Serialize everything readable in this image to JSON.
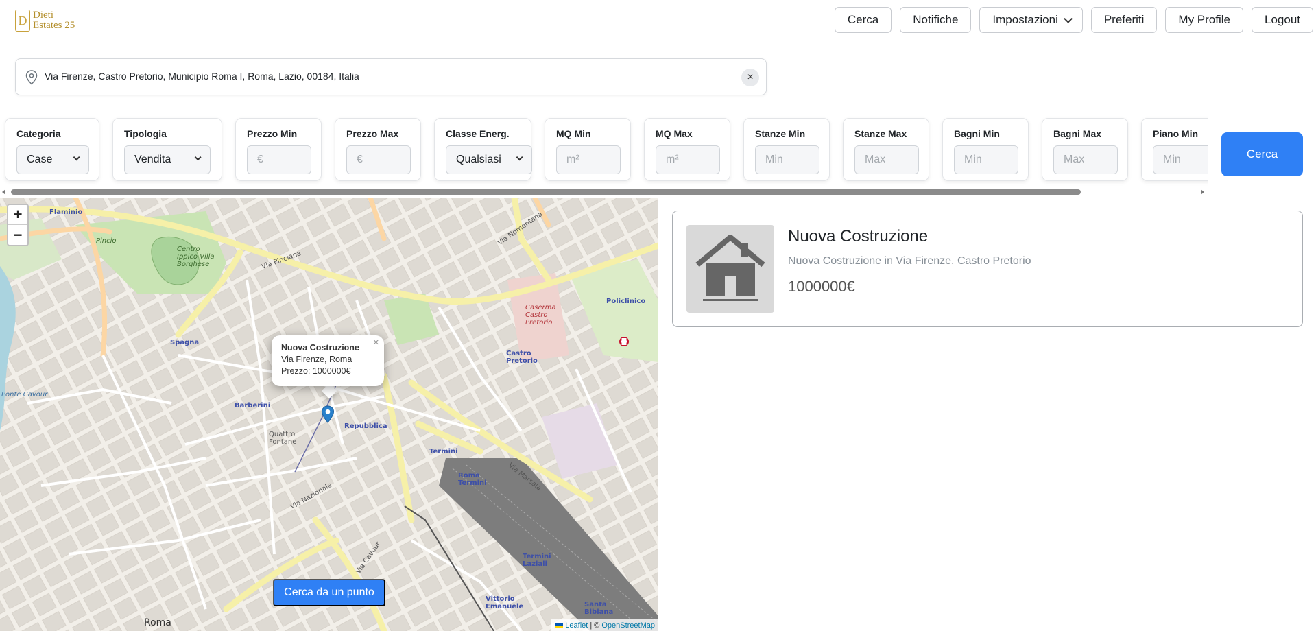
{
  "brand": {
    "name_line1": "Dieti",
    "name_line2": "Estates 25",
    "mark": "D"
  },
  "nav": {
    "cerca": "Cerca",
    "notifiche": "Notifiche",
    "impostazioni": "Impostazioni",
    "preferiti": "Preferiti",
    "profile": "My Profile",
    "logout": "Logout"
  },
  "search": {
    "address": "Via Firenze, Castro Pretorio, Municipio Roma I, Roma, Lazio, 00184, Italia",
    "clear_icon": "×"
  },
  "filters": [
    {
      "label": "Categoria",
      "value": "Case",
      "type": "select"
    },
    {
      "label": "Tipologia",
      "value": "Vendita",
      "type": "select"
    },
    {
      "label": "Prezzo Min",
      "placeholder": "€",
      "type": "input"
    },
    {
      "label": "Prezzo Max",
      "placeholder": "€",
      "type": "input"
    },
    {
      "label": "Classe Energ.",
      "value": "Qualsiasi",
      "type": "select"
    },
    {
      "label": "MQ Min",
      "placeholder": "m²",
      "type": "input"
    },
    {
      "label": "MQ Max",
      "placeholder": "m²",
      "type": "input"
    },
    {
      "label": "Stanze Min",
      "placeholder": "Min",
      "type": "input"
    },
    {
      "label": "Stanze Max",
      "placeholder": "Max",
      "type": "input"
    },
    {
      "label": "Bagni Min",
      "placeholder": "Min",
      "type": "input"
    },
    {
      "label": "Bagni Max",
      "placeholder": "Max",
      "type": "input"
    },
    {
      "label": "Piano Min",
      "placeholder": "Min",
      "type": "input"
    }
  ],
  "search_button": "Cerca",
  "map": {
    "zoom_in": "+",
    "zoom_out": "−",
    "popup": {
      "title": "Nuova Costruzione",
      "address": "Via Firenze, Roma",
      "price": "Prezzo: 1000000€",
      "close": "×"
    },
    "point_search_button": "Cerca da un punto",
    "attribution": {
      "leaflet": "Leaflet",
      "sep": "| ©",
      "osm": "OpenStreetMap"
    },
    "labels": {
      "flaminio": "Flaminio",
      "spagna": "Spagna",
      "barberini": "Barberini",
      "repubblica": "Repubblica",
      "termini": "Termini",
      "roma_termini": "Roma Termini",
      "castro_pretorio": "Castro Pretorio",
      "policlinico": "Policlinico",
      "termini_laziali": "Termini Laziali",
      "vittorio": "Vittorio Emanuele",
      "santa_bibiana": "Santa Bibiana",
      "roma": "Roma",
      "quattro_fontane": "Quattro Fontane",
      "caserma": "Caserma Castro Pretorio",
      "centro_ippico": "Centro Ippico Villa Borghese",
      "via_nomentana": "Via Nomentana",
      "via_pinciana": "Via Pinciana",
      "via_marsala": "Via Marsala",
      "via_nazionale": "Via Nazionale",
      "via_cavour": "Via Cavour",
      "ponte_cavour": "Ponte Cavour",
      "pincio": "Pincio"
    }
  },
  "result": {
    "title": "Nuova Costruzione",
    "subtitle": "Nuova Costruzione in Via Firenze, Castro Pretorio",
    "price": "1000000€",
    "thumb_icon": "house-icon"
  }
}
